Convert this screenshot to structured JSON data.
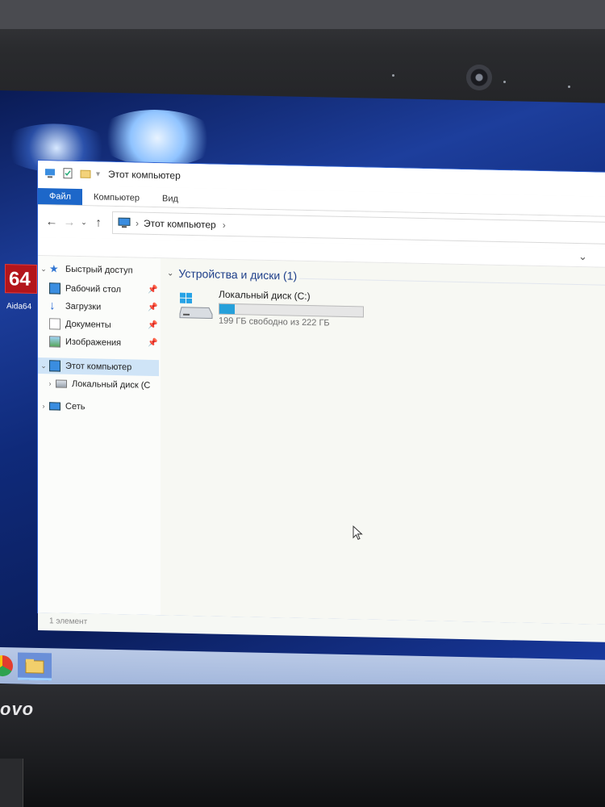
{
  "window": {
    "title": "Этот компьютер"
  },
  "ribbon": {
    "tabs": [
      {
        "label": "Файл"
      },
      {
        "label": "Компьютер"
      },
      {
        "label": "Вид"
      }
    ]
  },
  "address": {
    "path_item": "Этот компьютер"
  },
  "navpane": {
    "quick_access": "Быстрый доступ",
    "desktop": "Рабочий стол",
    "downloads": "Загрузки",
    "documents": "Документы",
    "images": "Изображения",
    "this_pc": "Этот компьютер",
    "local_disk": "Локальный диск (C",
    "network": "Сеть"
  },
  "content": {
    "group_header": "Устройства и диски (1)",
    "drive": {
      "name": "Локальный диск (C:)",
      "free_text": "199 ГБ свободно из 222 ГБ",
      "used_fraction": 0.104
    }
  },
  "status": {
    "item_count": "1 элемент"
  },
  "desktop": {
    "aida_icon_text": "64",
    "aida_label": "Aida64"
  },
  "bezel": {
    "brand": "ovo"
  },
  "colors": {
    "accent": "#1d67c9",
    "selection": "#cfe4f7",
    "drive_bar": "#26a0da"
  }
}
